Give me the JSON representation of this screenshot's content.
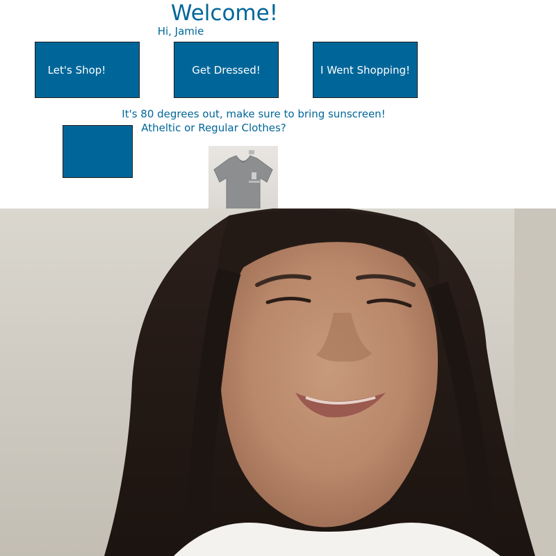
{
  "header": {
    "title": "Welcome!",
    "greeting": "Hi, Jamie"
  },
  "nav": {
    "shop_label": "Let's Shop!",
    "dressed_label": "Get Dressed!",
    "went_label": "I Went Shopping!"
  },
  "weather": {
    "message": "It's 80 degrees out, make sure to bring sunscreen!",
    "question": "Atheltic or Regular Clothes?"
  },
  "icons": {
    "clothing_thumbnail": "shirt-icon",
    "camera_feed": "camera-feed"
  },
  "colors": {
    "accent": "#006699",
    "button_text": "#ffffff"
  }
}
